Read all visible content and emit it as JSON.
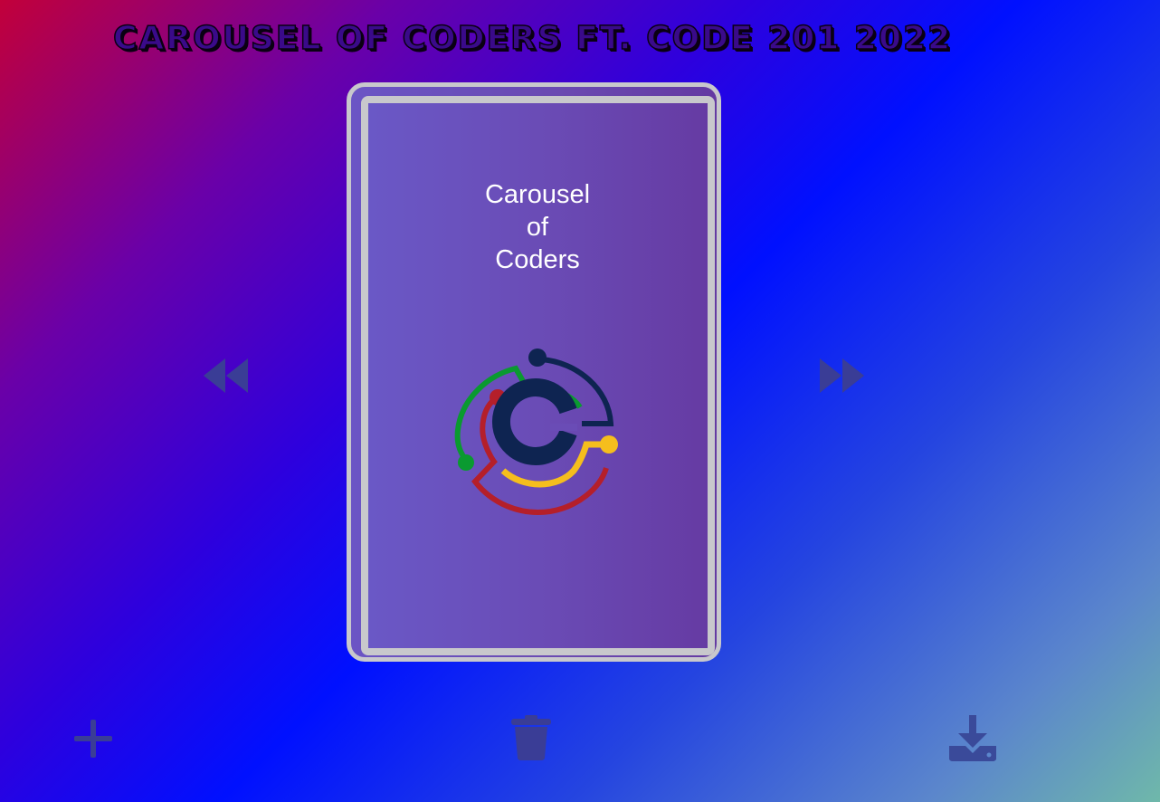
{
  "header": {
    "title": "Carousel of Coders ft. Code 201 2022"
  },
  "card": {
    "title_lines": [
      "Carousel",
      "of",
      "Coders"
    ],
    "logo_icon": "code-fellows-c-logo-icon"
  },
  "controls": {
    "prev_icon": "fast-backward-icon",
    "next_icon": "fast-forward-icon",
    "add_icon": "plus-icon",
    "delete_icon": "trash-icon",
    "download_icon": "download-icon"
  },
  "colors": {
    "icon": "#3a3d96",
    "card_border": "#c8c8cc",
    "card_bg": "#6a4cb6",
    "logo_navy": "#0e2451",
    "logo_green": "#0a9a30",
    "logo_red": "#b51f2a",
    "logo_yellow": "#f5be1d"
  }
}
